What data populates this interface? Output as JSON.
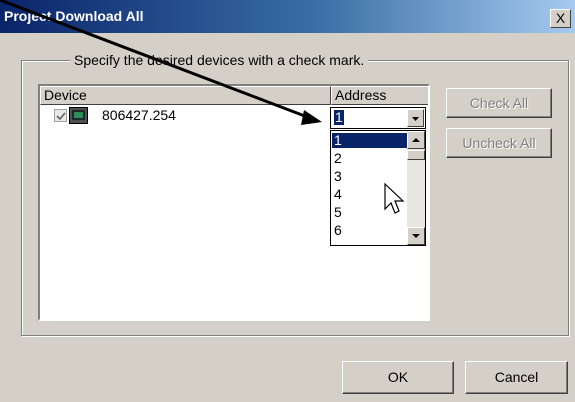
{
  "dialog": {
    "title": "Project Download All",
    "close_label": "X",
    "group_label": "Specify the desired devices with a check mark."
  },
  "list": {
    "columns": {
      "device": "Device",
      "address": "Address"
    },
    "rows": [
      {
        "device": "806427.254",
        "checked": true
      }
    ]
  },
  "address_combo": {
    "value": "1",
    "options": [
      "1",
      "2",
      "3",
      "4",
      "5",
      "6"
    ],
    "selected_option": "1"
  },
  "buttons": {
    "check_all": "Check All",
    "uncheck_all": "Uncheck All",
    "ok": "OK",
    "cancel": "Cancel"
  },
  "colors": {
    "titlebar_start": "#0a246a",
    "titlebar_end": "#a6caf0",
    "selection": "#0a246a",
    "dialog_bg": "#d4d0c8"
  }
}
